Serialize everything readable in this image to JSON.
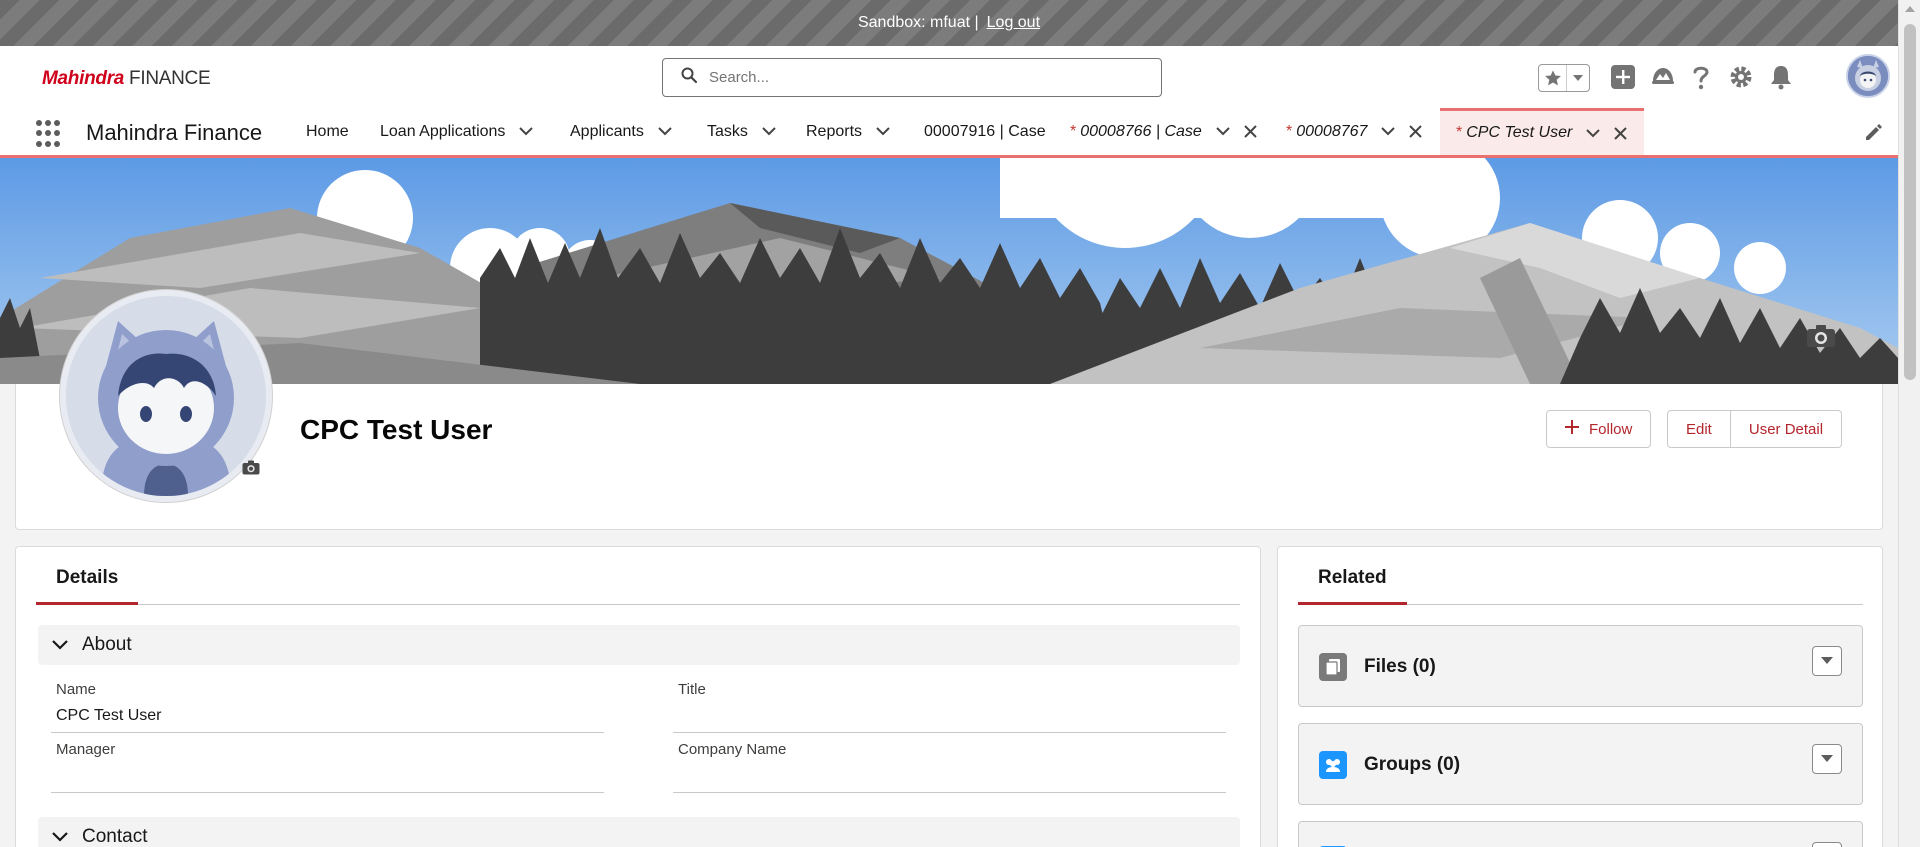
{
  "sandbox": {
    "label": "Sandbox: mfuat |",
    "logout": "Log out"
  },
  "header": {
    "logo_brand": "Mahindra",
    "logo_suffix": "FINANCE",
    "search_placeholder": "Search..."
  },
  "nav": {
    "app_name": "Mahindra Finance",
    "items": [
      {
        "label": "Home"
      },
      {
        "label": "Loan Applications"
      },
      {
        "label": "Applicants"
      },
      {
        "label": "Tasks"
      },
      {
        "label": "Reports"
      },
      {
        "label": "00007916 | Case"
      }
    ],
    "workspace_tabs": [
      {
        "prefix": "*",
        "label": "00008766 | Case"
      },
      {
        "prefix": "*",
        "label": "00008767"
      },
      {
        "prefix": "*",
        "label": "CPC Test User"
      }
    ]
  },
  "profile": {
    "name": "CPC Test User",
    "buttons": {
      "follow": "Follow",
      "edit": "Edit",
      "user_detail": "User Detail"
    }
  },
  "details": {
    "tab": "Details",
    "sections": {
      "about": "About",
      "contact": "Contact"
    },
    "fields": {
      "name_label": "Name",
      "name_value": "CPC Test User",
      "title_label": "Title",
      "title_value": "",
      "manager_label": "Manager",
      "manager_value": "",
      "company_label": "Company Name",
      "company_value": ""
    }
  },
  "related": {
    "tab": "Related",
    "cards": [
      {
        "title": "Files (0)",
        "icon": "files-icon",
        "color": "#7a7a7a"
      },
      {
        "title": "Groups (0)",
        "icon": "groups-icon",
        "color": "#1b96ff"
      }
    ]
  },
  "colors": {
    "accent": "#b3262d",
    "nav_active_border": "#ea6f6f",
    "brand_red": "#d0021b"
  }
}
